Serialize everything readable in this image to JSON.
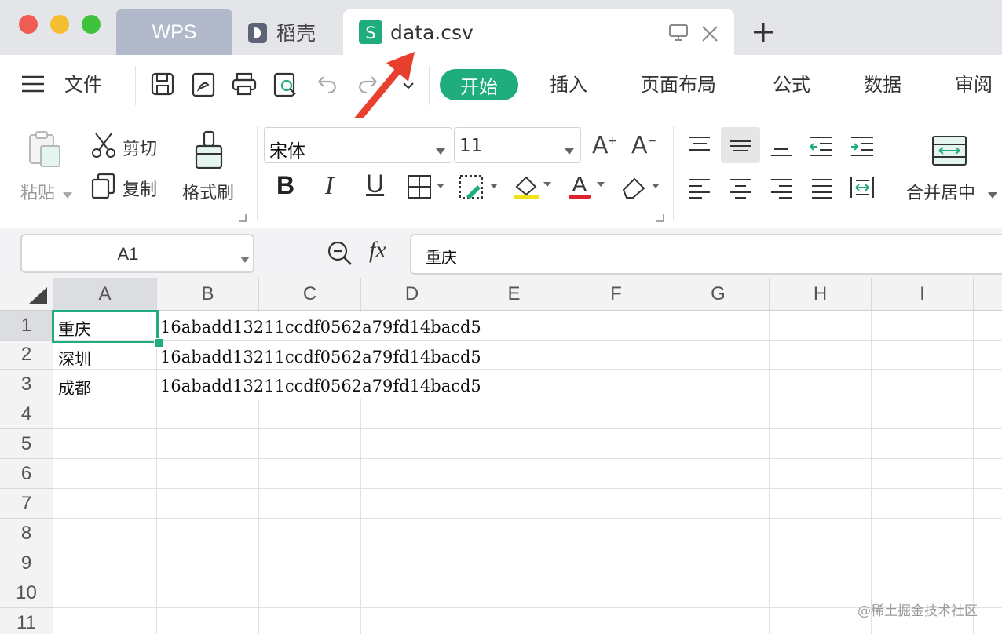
{
  "tabs": {
    "wps": "WPS",
    "daoke": "稻壳",
    "file": "data.csv"
  },
  "menu": {
    "file_label": "文件",
    "tabs": [
      "开始",
      "插入",
      "页面布局",
      "公式",
      "数据",
      "审阅"
    ],
    "active_tab": "开始"
  },
  "ribbon": {
    "paste": "粘贴",
    "cut": "剪切",
    "copy": "复制",
    "format_painter": "格式刷",
    "font_name": "宋体",
    "font_size": "11",
    "bold": "B",
    "italic": "I",
    "underline": "U",
    "merge_center": "合并居中"
  },
  "formula_bar": {
    "name_box": "A1",
    "fx": "fx",
    "value": "重庆"
  },
  "sheet": {
    "columns": [
      "A",
      "B",
      "C",
      "D",
      "E",
      "F",
      "G",
      "H",
      "I"
    ],
    "rows": [
      "1",
      "2",
      "3",
      "4",
      "5",
      "6",
      "7",
      "8",
      "9",
      "10",
      "11"
    ],
    "data": [
      [
        "重庆",
        "16abadd13211ccdf0562a79fd14bacd5"
      ],
      [
        "深圳",
        "16abadd13211ccdf0562a79fd14bacd5"
      ],
      [
        "成都",
        "16abadd13211ccdf0562a79fd14bacd5"
      ]
    ],
    "selected_cell": "A1"
  },
  "watermark": "@稀土掘金技术社区",
  "colors": {
    "accent_green": "#1fad7e",
    "tab_wps_bg": "#b2b9cb",
    "titlebar_bg": "#e4e5e9",
    "arrow_red": "#e8402e"
  }
}
